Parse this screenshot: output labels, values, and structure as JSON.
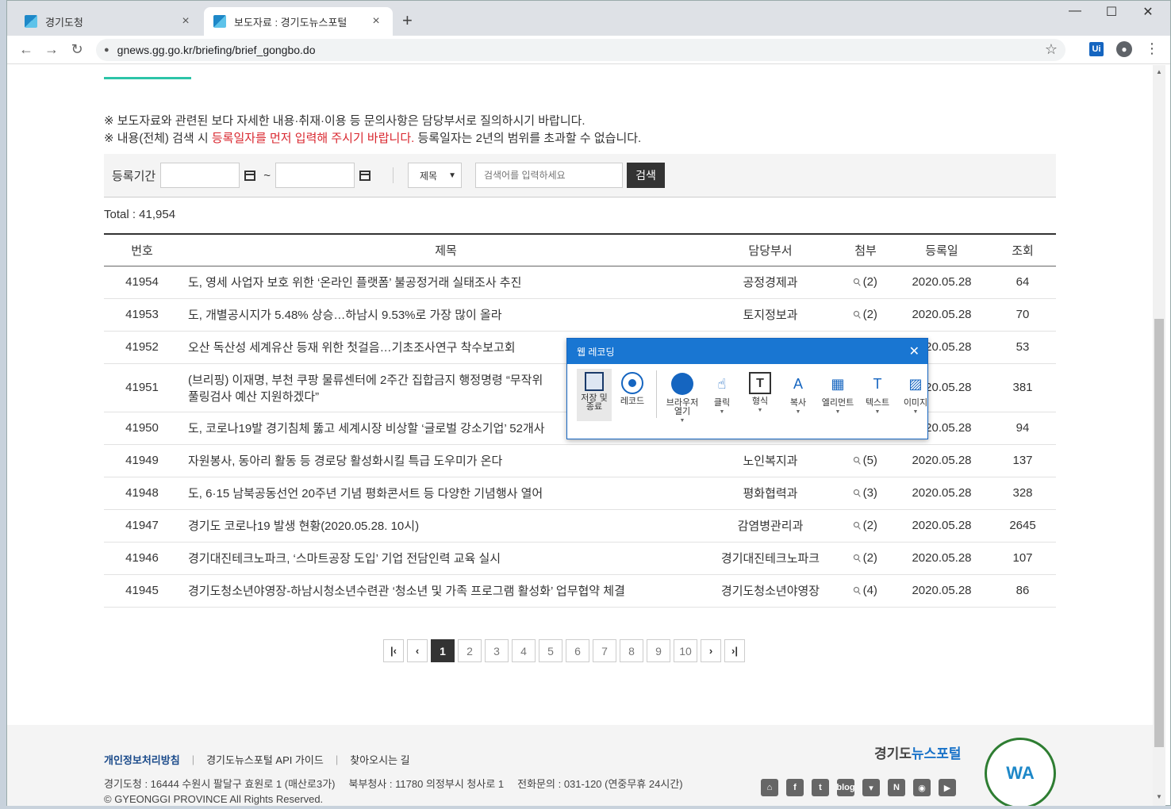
{
  "browser": {
    "tabs": [
      {
        "title": "경기도청",
        "close": "×"
      },
      {
        "title": "보도자료 : 경기도뉴스포털",
        "close": "×"
      }
    ],
    "new_tab": "+",
    "controls": {
      "minimize": "—",
      "maximize": "☐",
      "close": "✕"
    },
    "nav": {
      "back": "←",
      "forward": "→",
      "reload": "↻"
    },
    "url": "gnews.gg.go.kr/briefing/brief_gongbo.do",
    "ext_label": "Ui"
  },
  "notice": {
    "line1": "※ 보도자료와 관련된 보다 자세한 내용·취재·이용 등 문의사항은 담당부서로 질의하시기 바랍니다.",
    "line2_prefix": "※ 내용(전체) 검색 시 ",
    "line2_red": "등록일자를 먼저 입력해 주시기 바랍니다.",
    "line2_suffix": " 등록일자는 2년의 범위를 초과할 수 없습니다."
  },
  "search": {
    "period_label": "등록기간",
    "tilde": "~",
    "select_value": "제목",
    "placeholder": "검색어를 입력하세요",
    "button": "검색"
  },
  "total": "Total : 41,954",
  "table": {
    "headers": [
      "번호",
      "제목",
      "담당부서",
      "첨부",
      "등록일",
      "조회"
    ],
    "rows": [
      {
        "num": "41954",
        "title": "도, 영세 사업자 보호 위한 ‘온라인 플랫폼’ 불공정거래 실태조사 추진",
        "dept": "공정경제과",
        "att": "(2)",
        "date": "2020.05.28",
        "views": "64"
      },
      {
        "num": "41953",
        "title": "도, 개별공시지가 5.48% 상승…하남시 9.53%로 가장 많이 올라",
        "dept": "토지정보과",
        "att": "(2)",
        "date": "2020.05.28",
        "views": "70"
      },
      {
        "num": "41952",
        "title": "오산 독산성 세계유산 등재 위한 첫걸음…기초조사연구 착수보고회",
        "dept": "",
        "att": "",
        "date": "2020.05.28",
        "views": "53"
      },
      {
        "num": "41951",
        "title": "(브리핑) 이재명, 부천 쿠팡 물류센터에 2주간 집합금지 행정명령 “무작위",
        "title2": "풀링검사 예산 지원하겠다”",
        "dept": "",
        "att": "",
        "date": "2020.05.28",
        "views": "381"
      },
      {
        "num": "41950",
        "title": "도, 코로나19발 경기침체 뚫고 세계시장 비상할 ‘글로벌 강소기업’ 52개사",
        "dept": "",
        "att": "",
        "date": "2020.05.28",
        "views": "94"
      },
      {
        "num": "41949",
        "title": "자원봉사, 동아리 활동 등 경로당 활성화시킬 특급 도우미가 온다",
        "dept": "노인복지과",
        "att": "(5)",
        "date": "2020.05.28",
        "views": "137"
      },
      {
        "num": "41948",
        "title": "도, 6·15 남북공동선언 20주년 기념 평화콘서트 등 다양한 기념행사 열어",
        "dept": "평화협력과",
        "att": "(3)",
        "date": "2020.05.28",
        "views": "328"
      },
      {
        "num": "41947",
        "title": "경기도 코로나19 발생 현황(2020.05.28. 10시)",
        "dept": "감염병관리과",
        "att": "(2)",
        "date": "2020.05.28",
        "views": "2645"
      },
      {
        "num": "41946",
        "title": "경기대진테크노파크, ‘스마트공장 도입’ 기업 전담인력 교육 실시",
        "dept": "경기대진테크노파크",
        "att": "(2)",
        "date": "2020.05.28",
        "views": "107"
      },
      {
        "num": "41945",
        "title": "경기도청소년야영장-하남시청소년수련관 ‘청소년 및 가족 프로그램 활성화’ 업무협약 체결",
        "dept": "경기도청소년야영장",
        "att": "(4)",
        "date": "2020.05.28",
        "views": "86"
      }
    ]
  },
  "pagination": {
    "first": "|‹",
    "prev": "‹",
    "pages": [
      "1",
      "2",
      "3",
      "4",
      "5",
      "6",
      "7",
      "8",
      "9",
      "10"
    ],
    "current": "1",
    "next": "›",
    "last": "›|"
  },
  "footer": {
    "privacy": "개인정보처리방침",
    "api_guide": "경기도뉴스포털 API 가이드",
    "directions": "찾아오시는 길",
    "addr1": "경기도청 : 16444 수원시 팔달구 효원로 1 (매산로3가)",
    "addr2": "북부청사 : 11780 의정부시 청사로 1",
    "phone": "전화문의 : 031-120 (연중무휴 24시간)",
    "copyright": "© GYEONGGI PROVINCE All Rights Reserved.",
    "logo_part1": "경기도",
    "logo_part2": "뉴스포털",
    "social_blog": "blog",
    "wa_badge": "WA"
  },
  "recorder": {
    "title": "웹 레코딩",
    "tools": {
      "save": "저장 및 종료",
      "record": "레코드",
      "browser": "브라우저 열기",
      "click": "클릭",
      "form": "형식",
      "copy": "복사",
      "element": "엘리먼트",
      "text": "텍스트",
      "image": "이미지"
    }
  },
  "icons": {
    "attachment": "paperclip-icon",
    "lock": "lock-icon",
    "star": "star-icon",
    "calendar": "calendar-icon"
  },
  "colors": {
    "accent_teal": "#2cc4a8",
    "notice_red": "#d9262e",
    "recorder_blue": "#1976d2"
  }
}
